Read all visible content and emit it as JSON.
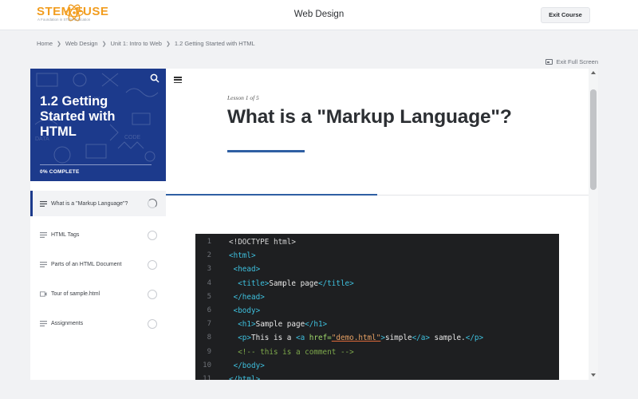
{
  "header": {
    "logo_text": "STEM FUSE",
    "logo_tagline": "A Foundation in STEM Education",
    "course_title": "Web Design",
    "exit_course_label": "Exit Course"
  },
  "breadcrumb": [
    "Home",
    "Web Design",
    "Unit 1: Intro to Web",
    "1.2 Getting Started with HTML"
  ],
  "exit_fullscreen_label": "Exit Full Screen",
  "sidebar": {
    "title": "1.2 Getting Started with HTML",
    "progress_label": "0% COMPLETE",
    "progress_fraction": 0,
    "lessons": [
      {
        "label": "What is a \"Markup Language\"?",
        "icon": "text-lines-icon",
        "status": "in-progress"
      },
      {
        "label": "HTML Tags",
        "icon": "text-lines-icon",
        "status": "not-started"
      },
      {
        "label": "Parts of an HTML Document",
        "icon": "text-lines-icon",
        "status": "not-started"
      },
      {
        "label": "Tour of sample.html",
        "icon": "video-icon",
        "status": "not-started"
      },
      {
        "label": "Assignments",
        "icon": "text-lines-icon",
        "status": "not-started"
      }
    ]
  },
  "lesson": {
    "counter": "Lesson 1 of 5",
    "heading": "What is a \"Markup Language\"?",
    "scroll_progress_fraction": 0.5
  },
  "code_lines": [
    {
      "n": "1",
      "parts": [
        [
          "t",
          "<!DOCTYPE html>"
        ]
      ]
    },
    {
      "n": "2",
      "parts": [
        [
          "tag",
          "<html>"
        ]
      ]
    },
    {
      "n": "3",
      "parts": [
        [
          "txt",
          " "
        ],
        [
          "tag",
          "<head>"
        ]
      ]
    },
    {
      "n": "4",
      "parts": [
        [
          "txt",
          "  "
        ],
        [
          "tag",
          "<title>"
        ],
        [
          "txt",
          "Sample page"
        ],
        [
          "tag",
          "</title>"
        ]
      ]
    },
    {
      "n": "5",
      "parts": [
        [
          "txt",
          " "
        ],
        [
          "tag",
          "</head>"
        ]
      ]
    },
    {
      "n": "6",
      "parts": [
        [
          "txt",
          " "
        ],
        [
          "tag",
          "<body>"
        ]
      ]
    },
    {
      "n": "7",
      "parts": [
        [
          "txt",
          "  "
        ],
        [
          "tag",
          "<h1>"
        ],
        [
          "txt",
          "Sample page"
        ],
        [
          "tag",
          "</h1>"
        ]
      ]
    },
    {
      "n": "8",
      "parts": [
        [
          "txt",
          "  "
        ],
        [
          "tag",
          "<p>"
        ],
        [
          "txt",
          "This is a "
        ],
        [
          "tag",
          "<a "
        ],
        [
          "attr",
          "href="
        ],
        [
          "str",
          "\"demo.html\""
        ],
        [
          "tag",
          ">"
        ],
        [
          "txt",
          "simple"
        ],
        [
          "tag",
          "</a>"
        ],
        [
          "txt",
          " sample."
        ],
        [
          "tag",
          "</p>"
        ]
      ]
    },
    {
      "n": "9",
      "parts": [
        [
          "txt",
          "  "
        ],
        [
          "cmt",
          "<!-- this is a comment -->"
        ]
      ]
    },
    {
      "n": "10",
      "parts": [
        [
          "txt",
          " "
        ],
        [
          "tag",
          "</body>"
        ]
      ]
    },
    {
      "n": "11",
      "parts": [
        [
          "tag",
          "</html>"
        ]
      ]
    }
  ],
  "colors": {
    "brand_orange": "#f29d1f",
    "sidebar_blue": "#1c3a8c",
    "accent_blue": "#2f5fa3"
  }
}
